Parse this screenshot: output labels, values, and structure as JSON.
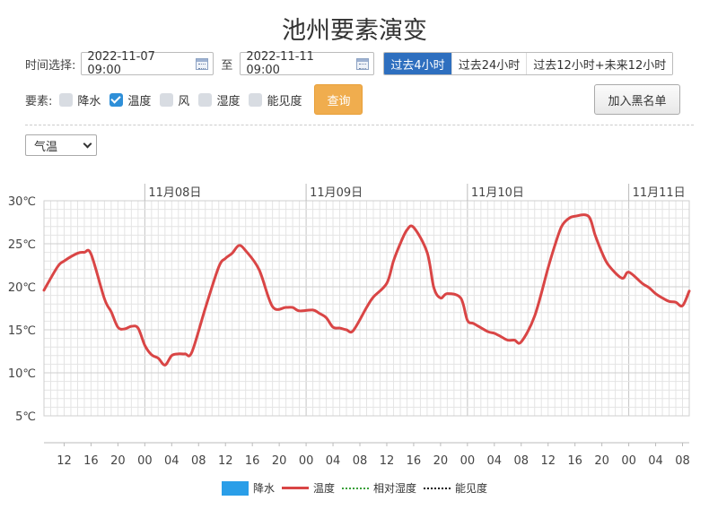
{
  "title": "池州要素演变",
  "time_select": {
    "label": "时间选择:",
    "start": "2022-11-07 09:00",
    "to_label": "至",
    "end": "2022-11-11 09:00",
    "ranges": [
      "过去4小时",
      "过去24小时",
      "过去12小时+未来12小时"
    ],
    "active_range": 0
  },
  "elements": {
    "label": "要素:",
    "options": [
      {
        "label": "降水",
        "checked": false
      },
      {
        "label": "温度",
        "checked": true
      },
      {
        "label": "风",
        "checked": false
      },
      {
        "label": "湿度",
        "checked": false
      },
      {
        "label": "能见度",
        "checked": false
      }
    ],
    "query_label": "查询"
  },
  "blacklist_label": "加入黑名单",
  "variable_select": "气温",
  "chart_data": {
    "type": "line",
    "title": "",
    "xlabel": "",
    "ylabel": "",
    "y_unit": "℃",
    "ylim": [
      5,
      30
    ],
    "yticks": [
      "5℃",
      "10℃",
      "15℃",
      "20℃",
      "25℃",
      "30℃"
    ],
    "x_start": "2022-11-07 09:00",
    "x_end": "2022-11-11 09:00",
    "date_labels": [
      "11月08日",
      "11月09日",
      "11月10日",
      "11月11日"
    ],
    "hour_ticks": [
      "12",
      "16",
      "20",
      "00",
      "04",
      "08",
      "12",
      "16",
      "20",
      "00",
      "04",
      "08",
      "12",
      "16",
      "20",
      "00",
      "04",
      "08",
      "12",
      "16",
      "20",
      "00",
      "04",
      "08"
    ],
    "grid": true,
    "legend_position": "bottom",
    "series": [
      {
        "name": "温度",
        "color": "#d94545",
        "x": [
          "2022-11-07 09:00",
          "2022-11-07 11:00",
          "2022-11-07 12:00",
          "2022-11-07 14:00",
          "2022-11-07 15:00",
          "2022-11-07 16:00",
          "2022-11-07 18:00",
          "2022-11-07 19:00",
          "2022-11-07 20:00",
          "2022-11-07 21:00",
          "2022-11-07 22:00",
          "2022-11-07 23:00",
          "2022-11-08 00:00",
          "2022-11-08 01:00",
          "2022-11-08 02:00",
          "2022-11-08 03:00",
          "2022-11-08 04:00",
          "2022-11-08 05:00",
          "2022-11-08 06:00",
          "2022-11-08 07:00",
          "2022-11-08 09:00",
          "2022-11-08 11:00",
          "2022-11-08 12:00",
          "2022-11-08 13:00",
          "2022-11-08 14:00",
          "2022-11-08 15:00",
          "2022-11-08 17:00",
          "2022-11-08 19:00",
          "2022-11-08 21:00",
          "2022-11-08 22:00",
          "2022-11-08 23:00",
          "2022-11-09 01:00",
          "2022-11-09 02:00",
          "2022-11-09 03:00",
          "2022-11-09 04:00",
          "2022-11-09 05:00",
          "2022-11-09 06:00",
          "2022-11-09 07:00",
          "2022-11-09 09:00",
          "2022-11-09 10:00",
          "2022-11-09 12:00",
          "2022-11-09 13:00",
          "2022-11-09 14:00",
          "2022-11-09 15:00",
          "2022-11-09 16:00",
          "2022-11-09 18:00",
          "2022-11-09 19:00",
          "2022-11-09 20:00",
          "2022-11-09 21:00",
          "2022-11-09 23:00",
          "2022-11-10 00:00",
          "2022-11-10 01:00",
          "2022-11-10 03:00",
          "2022-11-10 04:00",
          "2022-11-10 05:00",
          "2022-11-10 06:00",
          "2022-11-10 07:00",
          "2022-11-10 08:00",
          "2022-11-10 10:00",
          "2022-11-10 12:00",
          "2022-11-10 13:00",
          "2022-11-10 14:00",
          "2022-11-10 15:00",
          "2022-11-10 16:00",
          "2022-11-10 18:00",
          "2022-11-10 19:00",
          "2022-11-10 20:00",
          "2022-11-10 21:00",
          "2022-11-10 23:00",
          "2022-11-11 00:00",
          "2022-11-11 02:00",
          "2022-11-11 03:00",
          "2022-11-11 04:00",
          "2022-11-11 05:00",
          "2022-11-11 06:00",
          "2022-11-11 07:00",
          "2022-11-11 08:00",
          "2022-11-11 09:00"
        ],
        "values": [
          19.6,
          22.3,
          23.0,
          23.9,
          24.0,
          23.8,
          18.6,
          17.1,
          15.3,
          15.1,
          15.4,
          15.2,
          13.2,
          12.1,
          11.7,
          10.9,
          12.0,
          12.2,
          12.2,
          12.4,
          17.5,
          22.3,
          23.3,
          23.9,
          24.8,
          24.2,
          22.0,
          17.7,
          17.6,
          17.6,
          17.2,
          17.3,
          16.9,
          16.4,
          15.3,
          15.2,
          15.0,
          14.9,
          17.6,
          18.8,
          20.4,
          23.0,
          25.0,
          26.6,
          26.9,
          24.0,
          19.9,
          18.7,
          19.2,
          18.7,
          16.1,
          15.7,
          14.8,
          14.6,
          14.2,
          13.8,
          13.8,
          13.6,
          16.6,
          22.2,
          24.8,
          27.0,
          27.9,
          28.2,
          28.2,
          26.0,
          24.0,
          22.5,
          21.0,
          21.7,
          20.4,
          19.9,
          19.2,
          18.7,
          18.3,
          18.2,
          17.8,
          19.5
        ]
      }
    ],
    "legend": [
      {
        "name": "降水",
        "style": "bar",
        "color": "#2a9ee8"
      },
      {
        "name": "温度",
        "style": "solid",
        "color": "#d94545"
      },
      {
        "name": "相对湿度",
        "style": "dotted",
        "color": "#3aa03a"
      },
      {
        "name": "能见度",
        "style": "dotted",
        "color": "#111111"
      }
    ]
  }
}
